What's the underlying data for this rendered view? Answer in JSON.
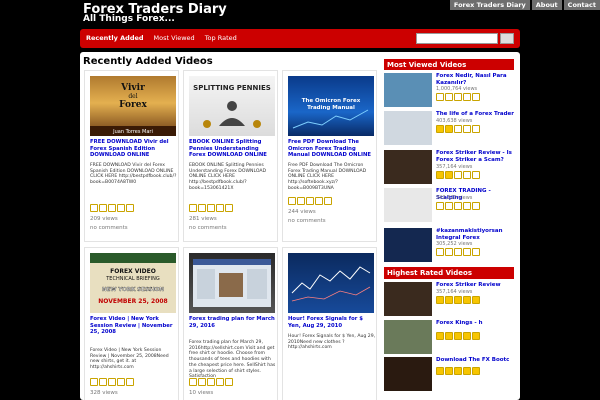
{
  "header": {
    "title": "Forex Traders Diary",
    "tagline": "All Things Forex...",
    "top_links": [
      "Forex Traders Diary",
      "About",
      "Contact"
    ]
  },
  "nav": {
    "tabs": [
      "Recently Added",
      "Most Viewed",
      "Top Rated"
    ],
    "search_placeholder": ""
  },
  "main": {
    "section_title": "Recently Added Videos",
    "cards": [
      {
        "title": "FREE DOWNLOAD Vivir del Forex Spanish Edition DOWNLOAD ONLINE",
        "desc": "FREE DOWNLOAD Vivir del Forex Spanish Edition DOWNLOAD ONLINE CLICK HERE http://bestpdfbook.club/?book=B0074A8TW0",
        "thumb_text": [
          "Vivir",
          "del",
          "Forex",
          "Juan Torres Mari"
        ],
        "rating": 0,
        "views": "209 views",
        "comments": "no comments"
      },
      {
        "title": "EBOOK ONLINE Splitting Pennies Understanding Forex DOWNLOAD ONLINE",
        "desc": "EBOOK ONLINE Splitting Pennies Understanding Forex DOWNLOAD ONLINE CLICK HERE http://bestpdfbook.club/?book=153061421X",
        "thumb_text": [
          "SPLITTING PENNIES"
        ],
        "rating": 0,
        "views": "281 views",
        "comments": "no comments"
      },
      {
        "title": "Free PDF Download The Omicron Forex Trading Manual DOWNLOAD ONLINE",
        "desc": "Free PDF Download The Omicron Forex Trading Manual DOWNLOAD ONLINE CLICK HERE http://softebook.xyz/?book=B009BT3UNA",
        "thumb_text": [
          "The Omicron Forex",
          "Trading Manual"
        ],
        "rating": 0,
        "views": "244 views",
        "comments": "no comments"
      },
      {
        "title": "Forex Video | New York Session Review | November 25, 2008",
        "desc": "Forex Video | New York Session Review | November 25, 2008Need new shirts, get it. at http://ahshirts.com",
        "thumb_text": [
          "FOREX VIDEO",
          "TECHNICAL BRIEFING",
          "NEW YORK SESSION",
          "NOVEMBER 25, 2008"
        ],
        "rating": 0,
        "views": "328 views",
        "comments": ""
      },
      {
        "title": "Forex trading plan for March 29, 2016",
        "desc": "Forex trading plan for March 29, 2016http://sellshirt.com Visit and get free shirt or hoodie. Choose from thousands of tees and hoodies with the cheapest price here. SellShirt has a large selection of shirt styles. Satisfaction",
        "thumb_text": [],
        "rating": 0,
        "views": "10 views",
        "comments": ""
      },
      {
        "title": "Hour! Forex Signals for $ Yen, Aug 29, 2010",
        "desc": "Hour! Forex Signals for $ Yen, Aug 29, 2010Need new clothes ? http://ahshirts.com",
        "thumb_text": [],
        "rating": 0,
        "views": "",
        "comments": ""
      }
    ]
  },
  "sidebar": {
    "most_viewed_title": "Most Viewed Videos",
    "most_viewed": [
      {
        "title": "Forex Nedir, Nasıl Para Kazanılır?",
        "views": "1,000,764 views",
        "rating": 0
      },
      {
        "title": "The life of a Forex Trader",
        "views": "403,638 views",
        "rating": 2
      },
      {
        "title": "Forex Striker Review - Is Forex Striker a Scam?",
        "views": "357,164 views",
        "rating": 2
      },
      {
        "title": "FOREX TRADING - Scalping",
        "views": "343,320 views",
        "rating": 0
      },
      {
        "title": "#kazanmakistiyorsan Integral Forex",
        "views": "305,252 views",
        "rating": 0
      }
    ],
    "highest_rated_title": "Highest Rated Videos",
    "highest_rated": [
      {
        "title": "Forex Striker Review",
        "views": "357,164 views",
        "rating": 5
      },
      {
        "title": "Forex Kings - h",
        "views": "",
        "rating": 5
      },
      {
        "title": "Download The FX Bootc",
        "views": "",
        "rating": 5
      }
    ]
  },
  "colors": {
    "accent": "#cc0000",
    "link": "#0000cc",
    "star": "#f7c500"
  }
}
